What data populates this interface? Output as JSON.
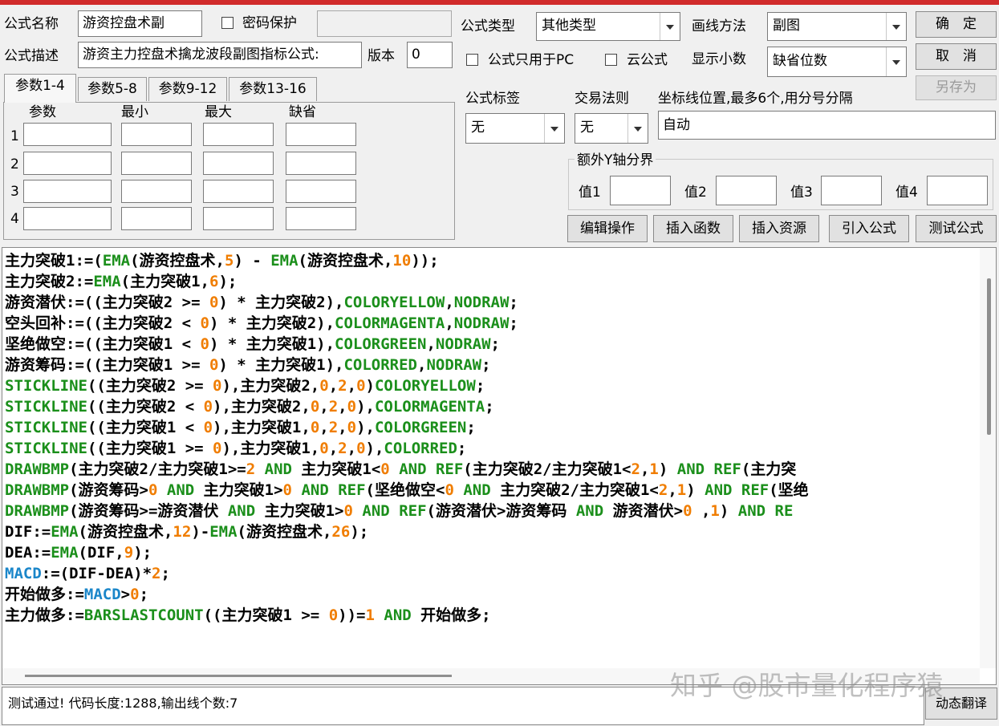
{
  "header": {
    "formula_name_label": "公式名称",
    "formula_name_value": "游资控盘术副",
    "password_label": "密码保护",
    "formula_desc_label": "公式描述",
    "formula_desc_value": "游资主力控盘术擒龙波段副图指标公式:",
    "version_label": "版本",
    "version_value": "0",
    "formula_type_label": "公式类型",
    "formula_type_value": "其他类型",
    "draw_method_label": "画线方法",
    "draw_method_value": "副图",
    "pc_only_label": "公式只用于PC",
    "cloud_label": "云公式",
    "decimals_label": "显示小数",
    "decimals_value": "缺省位数",
    "tag_label": "公式标签",
    "tag_value": "无",
    "trade_rule_label": "交易法则",
    "trade_rule_value": "无",
    "coord_label": "坐标线位置,最多6个,用分号分隔",
    "coord_value": "自动",
    "extra_y_label": "额外Y轴分界",
    "val1": "值1",
    "val2": "值2",
    "val3": "值3",
    "val4": "值4"
  },
  "buttons": {
    "ok": "确　定",
    "cancel": "取　消",
    "save_as": "另存为",
    "edit_ops": "编辑操作",
    "insert_func": "插入函数",
    "insert_res": "插入资源",
    "import_formula": "引入公式",
    "test_formula": "测试公式",
    "dyn_translate": "动态翻译"
  },
  "params": {
    "tabs": [
      "参数1-4",
      "参数5-8",
      "参数9-12",
      "参数13-16"
    ],
    "headers": [
      "参数",
      "最小",
      "最大",
      "缺省"
    ],
    "rows": [
      "1",
      "2",
      "3",
      "4"
    ]
  },
  "code_lines": [
    [
      [
        "主力突破1:=(",
        "k"
      ],
      [
        "EMA",
        "g"
      ],
      [
        "(游资控盘术,",
        "k"
      ],
      [
        "5",
        "o"
      ],
      [
        ") - ",
        "k"
      ],
      [
        "EMA",
        "g"
      ],
      [
        "(游资控盘术,",
        "k"
      ],
      [
        "10",
        "o"
      ],
      [
        "));",
        "k"
      ]
    ],
    [
      [
        "主力突破2:=",
        "k"
      ],
      [
        "EMA",
        "g"
      ],
      [
        "(主力突破1,",
        "k"
      ],
      [
        "6",
        "o"
      ],
      [
        ");",
        "k"
      ]
    ],
    [
      [
        "游资潜伏:=((主力突破2 >= ",
        "k"
      ],
      [
        "0",
        "o"
      ],
      [
        ") * 主力突破2),",
        "k"
      ],
      [
        "COLORYELLOW",
        "g"
      ],
      [
        ",",
        "k"
      ],
      [
        "NODRAW",
        "g"
      ],
      [
        ";",
        "k"
      ]
    ],
    [
      [
        "空头回补:=((主力突破2 < ",
        "k"
      ],
      [
        "0",
        "o"
      ],
      [
        ") * 主力突破2),",
        "k"
      ],
      [
        "COLORMAGENTA",
        "g"
      ],
      [
        ",",
        "k"
      ],
      [
        "NODRAW",
        "g"
      ],
      [
        ";",
        "k"
      ]
    ],
    [
      [
        "坚绝做空:=((主力突破1 < ",
        "k"
      ],
      [
        "0",
        "o"
      ],
      [
        ") * 主力突破1),",
        "k"
      ],
      [
        "COLORGREEN",
        "g"
      ],
      [
        ",",
        "k"
      ],
      [
        "NODRAW",
        "g"
      ],
      [
        ";",
        "k"
      ]
    ],
    [
      [
        "游资筹码:=((主力突破1 >= ",
        "k"
      ],
      [
        "0",
        "o"
      ],
      [
        ") * 主力突破1),",
        "k"
      ],
      [
        "COLORRED",
        "g"
      ],
      [
        ",",
        "k"
      ],
      [
        "NODRAW",
        "g"
      ],
      [
        ";",
        "k"
      ]
    ],
    [
      [
        "STICKLINE",
        "g"
      ],
      [
        "((主力突破2 >= ",
        "k"
      ],
      [
        "0",
        "o"
      ],
      [
        "),主力突破2,",
        "k"
      ],
      [
        "0",
        "o"
      ],
      [
        ",",
        "k"
      ],
      [
        "2",
        "o"
      ],
      [
        ",",
        "k"
      ],
      [
        "0",
        "o"
      ],
      [
        ")",
        "k"
      ],
      [
        "COLORYELLOW",
        "g"
      ],
      [
        ";",
        "k"
      ]
    ],
    [
      [
        "STICKLINE",
        "g"
      ],
      [
        "((主力突破2 < ",
        "k"
      ],
      [
        "0",
        "o"
      ],
      [
        "),主力突破2,",
        "k"
      ],
      [
        "0",
        "o"
      ],
      [
        ",",
        "k"
      ],
      [
        "2",
        "o"
      ],
      [
        ",",
        "k"
      ],
      [
        "0",
        "o"
      ],
      [
        "),",
        "k"
      ],
      [
        "COLORMAGENTA",
        "g"
      ],
      [
        ";",
        "k"
      ]
    ],
    [
      [
        "STICKLINE",
        "g"
      ],
      [
        "((主力突破1 < ",
        "k"
      ],
      [
        "0",
        "o"
      ],
      [
        "),主力突破1,",
        "k"
      ],
      [
        "0",
        "o"
      ],
      [
        ",",
        "k"
      ],
      [
        "2",
        "o"
      ],
      [
        ",",
        "k"
      ],
      [
        "0",
        "o"
      ],
      [
        "),",
        "k"
      ],
      [
        "COLORGREEN",
        "g"
      ],
      [
        ";",
        "k"
      ]
    ],
    [
      [
        "STICKLINE",
        "g"
      ],
      [
        "((主力突破1 >= ",
        "k"
      ],
      [
        "0",
        "o"
      ],
      [
        "),主力突破1,",
        "k"
      ],
      [
        "0",
        "o"
      ],
      [
        ",",
        "k"
      ],
      [
        "2",
        "o"
      ],
      [
        ",",
        "k"
      ],
      [
        "0",
        "o"
      ],
      [
        "),",
        "k"
      ],
      [
        "COLORRED",
        "g"
      ],
      [
        ";",
        "k"
      ]
    ],
    [
      [
        "DRAWBMP",
        "g"
      ],
      [
        "(主力突破2/主力突破1>=",
        "k"
      ],
      [
        "2",
        "o"
      ],
      [
        " ",
        "k"
      ],
      [
        "AND",
        "g"
      ],
      [
        " 主力突破1<",
        "k"
      ],
      [
        "0",
        "o"
      ],
      [
        " ",
        "k"
      ],
      [
        "AND",
        "g"
      ],
      [
        " ",
        "k"
      ],
      [
        "REF",
        "g"
      ],
      [
        "(主力突破2/主力突破1<",
        "k"
      ],
      [
        "2",
        "o"
      ],
      [
        ",",
        "k"
      ],
      [
        "1",
        "o"
      ],
      [
        ") ",
        "k"
      ],
      [
        "AND",
        "g"
      ],
      [
        " ",
        "k"
      ],
      [
        "REF",
        "g"
      ],
      [
        "(主力突",
        "k"
      ]
    ],
    [
      [
        "DRAWBMP",
        "g"
      ],
      [
        "(游资筹码>",
        "k"
      ],
      [
        "0",
        "o"
      ],
      [
        " ",
        "k"
      ],
      [
        "AND",
        "g"
      ],
      [
        " 主力突破1>",
        "k"
      ],
      [
        "0",
        "o"
      ],
      [
        " ",
        "k"
      ],
      [
        "AND",
        "g"
      ],
      [
        " ",
        "k"
      ],
      [
        "REF",
        "g"
      ],
      [
        "(坚绝做空<",
        "k"
      ],
      [
        "0",
        "o"
      ],
      [
        " ",
        "k"
      ],
      [
        "AND",
        "g"
      ],
      [
        " 主力突破2/主力突破1<",
        "k"
      ],
      [
        "2",
        "o"
      ],
      [
        ",",
        "k"
      ],
      [
        "1",
        "o"
      ],
      [
        ") ",
        "k"
      ],
      [
        "AND",
        "g"
      ],
      [
        " ",
        "k"
      ],
      [
        "REF",
        "g"
      ],
      [
        "(坚绝",
        "k"
      ]
    ],
    [
      [
        "DRAWBMP",
        "g"
      ],
      [
        "(游资筹码>=游资潜伏 ",
        "k"
      ],
      [
        "AND",
        "g"
      ],
      [
        " 主力突破1>",
        "k"
      ],
      [
        "0",
        "o"
      ],
      [
        " ",
        "k"
      ],
      [
        "AND",
        "g"
      ],
      [
        " ",
        "k"
      ],
      [
        "REF",
        "g"
      ],
      [
        "(游资潜伏>游资筹码 ",
        "k"
      ],
      [
        "AND",
        "g"
      ],
      [
        " 游资潜伏>",
        "k"
      ],
      [
        "0",
        "o"
      ],
      [
        " ,",
        "k"
      ],
      [
        "1",
        "o"
      ],
      [
        ") ",
        "k"
      ],
      [
        "AND",
        "g"
      ],
      [
        " RE",
        "g"
      ]
    ],
    [
      [
        "DIF:=",
        "k"
      ],
      [
        "EMA",
        "g"
      ],
      [
        "(游资控盘术,",
        "k"
      ],
      [
        "12",
        "o"
      ],
      [
        ")-",
        "k"
      ],
      [
        "EMA",
        "g"
      ],
      [
        "(游资控盘术,",
        "k"
      ],
      [
        "26",
        "o"
      ],
      [
        ");",
        "k"
      ]
    ],
    [
      [
        "DEA:=",
        "k"
      ],
      [
        "EMA",
        "g"
      ],
      [
        "(DIF,",
        "k"
      ],
      [
        "9",
        "o"
      ],
      [
        ");",
        "k"
      ]
    ],
    [
      [
        "MACD",
        "b"
      ],
      [
        ":=(DIF-DEA)*",
        "k"
      ],
      [
        "2",
        "o"
      ],
      [
        ";",
        "k"
      ]
    ],
    [
      [
        "开始做多:=",
        "k"
      ],
      [
        "MACD",
        "b"
      ],
      [
        ">",
        "k"
      ],
      [
        "0",
        "o"
      ],
      [
        ";",
        "k"
      ]
    ],
    [
      [
        "主力做多:=",
        "k"
      ],
      [
        "BARSLASTCOUNT",
        "g"
      ],
      [
        "((主力突破1 >= ",
        "k"
      ],
      [
        "0",
        "o"
      ],
      [
        "))=",
        "k"
      ],
      [
        "1",
        "o"
      ],
      [
        " ",
        "k"
      ],
      [
        "AND",
        "g"
      ],
      [
        " 开始做多;",
        "k"
      ]
    ]
  ],
  "status": "测试通过! 代码长度:1288,输出线个数:7",
  "watermark": "知乎 @股市量化程序猿"
}
